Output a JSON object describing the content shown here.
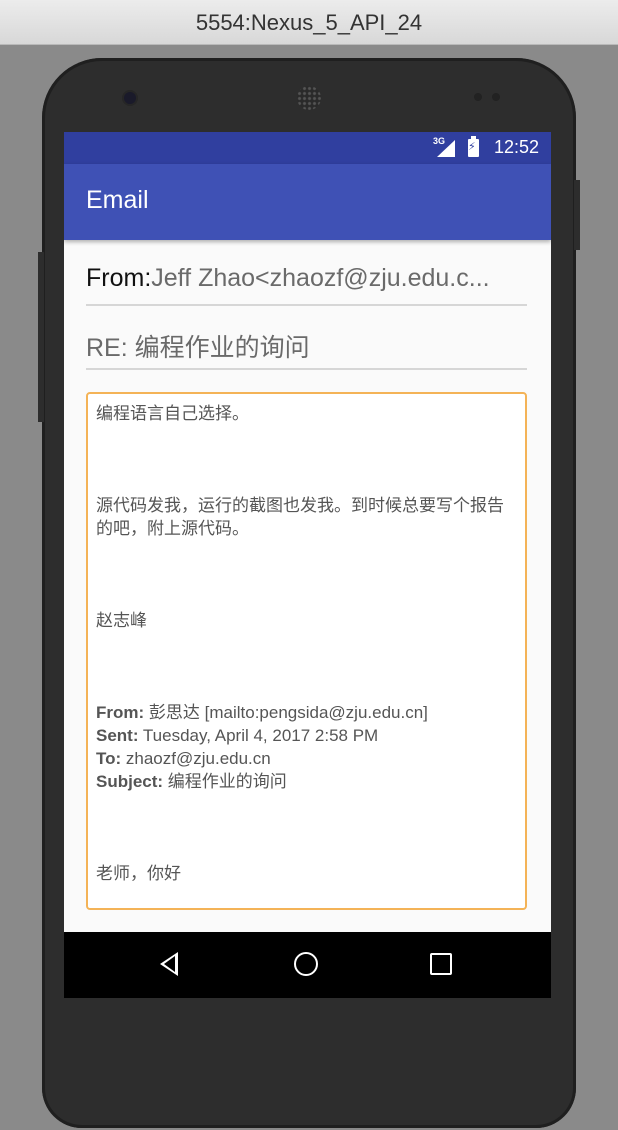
{
  "window": {
    "title": "5554:Nexus_5_API_24"
  },
  "statusbar": {
    "network": "3G",
    "time": "12:52"
  },
  "appbar": {
    "title": "Email"
  },
  "email": {
    "from_label": "From:",
    "from_value": "Jeff Zhao<zhaozf@zju.edu.c...",
    "subject": "RE: 编程作业的询问",
    "body": {
      "line1": "编程语言自己选择。",
      "line2": "源代码发我，运行的截图也发我。到时候总要写个报告的吧，附上源代码。",
      "signature": "赵志峰",
      "quoted": {
        "from_label": "From:",
        "from_value": " 彭思达 [mailto:pengsida@zju.edu.cn]",
        "sent_label": "Sent:",
        "sent_value": " Tuesday, April 4, 2017 2:58 PM",
        "to_label": "To:",
        "to_value": " zhaozf@zju.edu.cn",
        "subject_label": "Subject:",
        "subject_value": " 编程作业的询问"
      },
      "greeting": "老师，你好"
    }
  },
  "icons": {
    "back": "back-triangle-icon",
    "home": "home-circle-icon",
    "recent": "recent-square-icon"
  },
  "colors": {
    "statusbar": "#303f9f",
    "appbar": "#3f51b5",
    "body_border": "#f4b357"
  }
}
